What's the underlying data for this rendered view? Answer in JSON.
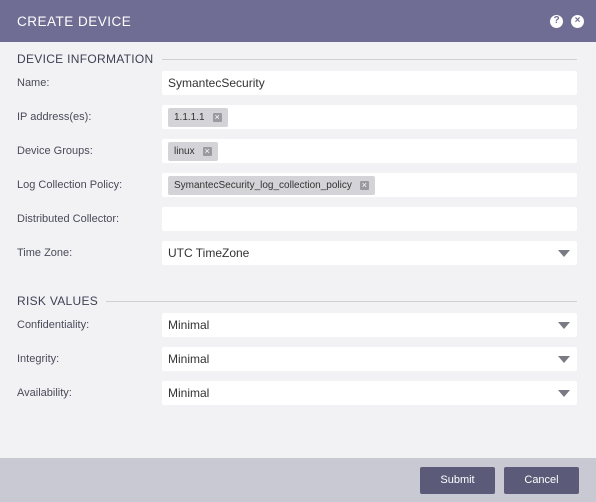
{
  "header": {
    "title": "CREATE DEVICE",
    "help_icon": "?",
    "close_icon": "×"
  },
  "sections": {
    "device_info": "DEVICE INFORMATION",
    "risk_values": "RISK VALUES"
  },
  "fields": {
    "name": {
      "label": "Name:",
      "value": "SymantecSecurity"
    },
    "ip": {
      "label": "IP address(es):",
      "tag": "1.1.1.1"
    },
    "groups": {
      "label": "Device Groups:",
      "tag": "linux"
    },
    "log_policy": {
      "label": "Log Collection Policy:",
      "tag": "SymantecSecurity_log_collection_policy"
    },
    "collector": {
      "label": "Distributed Collector:",
      "value": ""
    },
    "timezone": {
      "label": "Time Zone:",
      "value": "UTC TimeZone"
    },
    "confidentiality": {
      "label": "Confidentiality:",
      "value": "Minimal"
    },
    "integrity": {
      "label": "Integrity:",
      "value": "Minimal"
    },
    "availability": {
      "label": "Availability:",
      "value": "Minimal"
    }
  },
  "tag_remove_glyph": "×",
  "footer": {
    "submit": "Submit",
    "cancel": "Cancel"
  }
}
